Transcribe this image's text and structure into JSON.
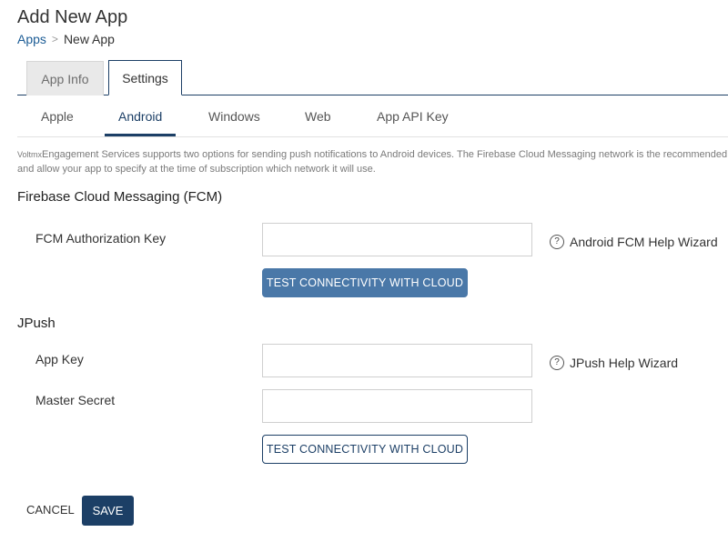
{
  "header": {
    "title": "Add New App",
    "breadcrumb": {
      "parent": "Apps",
      "separator": ">",
      "current": "New App"
    }
  },
  "tabs": [
    {
      "label": "App Info",
      "active": false
    },
    {
      "label": "Settings",
      "active": true
    }
  ],
  "subtabs": [
    {
      "label": "Apple",
      "active": false
    },
    {
      "label": "Android",
      "active": true
    },
    {
      "label": "Windows",
      "active": false
    },
    {
      "label": "Web",
      "active": false
    },
    {
      "label": "App API Key",
      "active": false
    }
  ],
  "description": {
    "brand": "Voltmx",
    "line1": "Engagement Services supports two options for sending push notifications to Android devices. The Firebase Cloud Messaging network is the recommended",
    "line2": "and allow your app to specify at the time of subscription which network it will use."
  },
  "fcm": {
    "title": "Firebase Cloud Messaging (FCM)",
    "auth_key_label": "FCM Authorization Key",
    "auth_key_value": "",
    "help_icon": "question-circle-icon",
    "help_glyph": "?",
    "help_label": "Android FCM Help Wizard",
    "test_button": "TEST CONNECTIVITY WITH CLOUD"
  },
  "jpush": {
    "title": "JPush",
    "app_key_label": "App Key",
    "app_key_value": "",
    "master_secret_label": "Master Secret",
    "master_secret_value": "",
    "help_icon": "question-circle-icon",
    "help_glyph": "?",
    "help_label": "JPush Help Wizard",
    "test_button": "TEST CONNECTIVITY WITH CLOUD"
  },
  "footer": {
    "cancel_label": "CANCEL",
    "save_label": "SAVE"
  },
  "colors": {
    "accent": "#1c3f66",
    "link": "#1c5c95",
    "primary_button": "#4a78a8"
  }
}
